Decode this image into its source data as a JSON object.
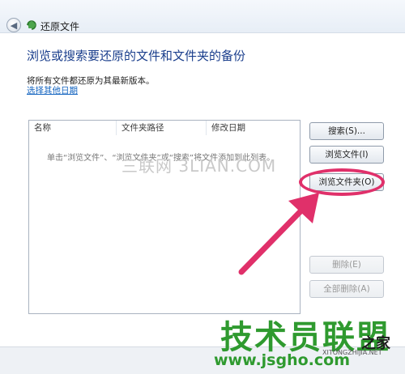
{
  "window": {
    "title": "还原文件",
    "back_glyph": "◀"
  },
  "main": {
    "heading": "浏览或搜索要还原的文件和文件夹的备份",
    "info": "将所有文件都还原为其最新版本。",
    "link": "选择其他日期"
  },
  "file_list": {
    "columns": [
      "名称",
      "文件夹路径",
      "修改日期"
    ],
    "empty_message": "单击“浏览文件”、“浏览文件夹”或“搜索”将文件添加到此列表。"
  },
  "buttons": {
    "search": "搜索(S)...",
    "browse_files": "浏览文件(I)",
    "browse_folders": "浏览文件夹(O)",
    "remove": "删除(E)",
    "remove_all": "全部删除(A)"
  },
  "annotation": {
    "color": "#e0306a"
  },
  "watermarks": {
    "center": "三联网 3LIAN.COM",
    "logo": "技术员联盟",
    "home": "之家",
    "url": "www.jsgho.com",
    "small": "XITONGZHIJIA.NET"
  }
}
